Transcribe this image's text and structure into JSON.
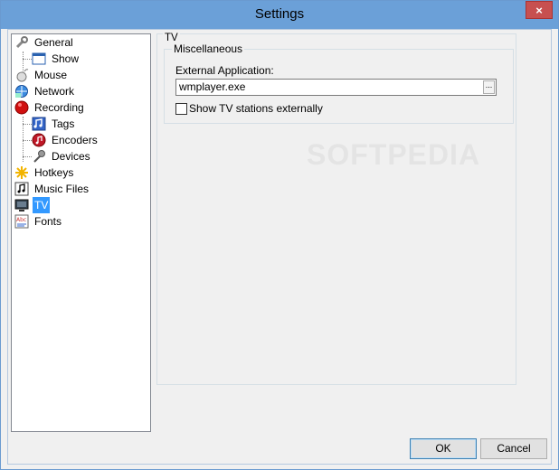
{
  "window": {
    "title": "Settings",
    "close_glyph": "×"
  },
  "tree": {
    "items": [
      {
        "label": "General",
        "icon": "wrench-icon",
        "level": 0
      },
      {
        "label": "Show",
        "icon": "window-icon",
        "level": 1
      },
      {
        "label": "Mouse",
        "icon": "mouse-icon",
        "level": 0
      },
      {
        "label": "Network",
        "icon": "network-globe-icon",
        "level": 0
      },
      {
        "label": "Recording",
        "icon": "record-icon",
        "level": 0
      },
      {
        "label": "Tags",
        "icon": "tags-icon",
        "level": 1
      },
      {
        "label": "Encoders",
        "icon": "music-disc-icon",
        "level": 1
      },
      {
        "label": "Devices",
        "icon": "microphone-icon",
        "level": 1
      },
      {
        "label": "Hotkeys",
        "icon": "hotkeys-icon",
        "level": 0
      },
      {
        "label": "Music Files",
        "icon": "music-note-icon",
        "level": 0
      },
      {
        "label": "TV",
        "icon": "tv-icon",
        "level": 0,
        "selected": true
      },
      {
        "label": "Fonts",
        "icon": "fonts-icon",
        "level": 0
      }
    ]
  },
  "tv_panel": {
    "title": "TV",
    "misc_group": {
      "title": "Miscellaneous",
      "external_app_label": "External Application:",
      "external_app_value": "wmplayer.exe",
      "browse_label": "...",
      "show_externally_label": "Show TV stations externally",
      "show_externally_checked": false
    }
  },
  "buttons": {
    "ok": "OK",
    "cancel": "Cancel"
  },
  "watermark": "SOFTPEDIA"
}
